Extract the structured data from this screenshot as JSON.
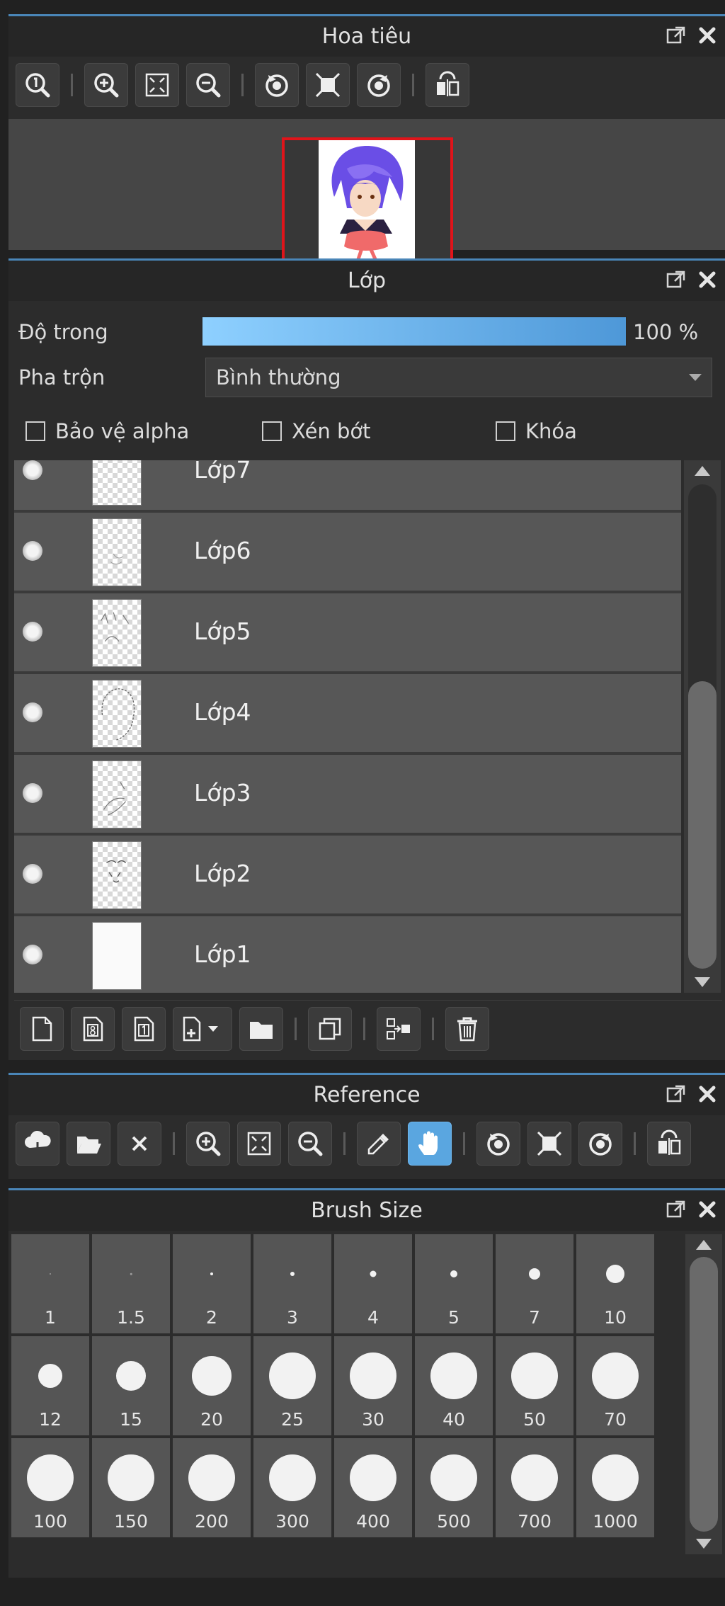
{
  "navigator": {
    "title": "Hoa tiêu"
  },
  "layers": {
    "title": "Lớp",
    "opacity_label": "Độ trong",
    "opacity_value_text": "100 %",
    "opacity_fraction": 1.0,
    "blend_label": "Pha trộn",
    "blend_value": "Bình thường",
    "check_alpha": "Bảo vệ alpha",
    "check_clip": "Xén bớt",
    "check_lock": "Khóa",
    "items": [
      {
        "name": "Lớp7"
      },
      {
        "name": "Lớp6"
      },
      {
        "name": "Lớp5"
      },
      {
        "name": "Lớp4"
      },
      {
        "name": "Lớp3"
      },
      {
        "name": "Lớp2"
      },
      {
        "name": "Lớp1"
      }
    ]
  },
  "reference": {
    "title": "Reference"
  },
  "brush": {
    "title": "Brush Size",
    "sizes": [
      "1",
      "1.5",
      "2",
      "3",
      "4",
      "5",
      "7",
      "10",
      "12",
      "15",
      "20",
      "25",
      "30",
      "40",
      "50",
      "70",
      "100",
      "150",
      "200",
      "300",
      "400",
      "500",
      "700",
      "1000"
    ]
  },
  "colors": {
    "accent": "#4a86b8",
    "active_tool": "#5aa6e0",
    "navigator_frame": "#e0141a",
    "panel_bg": "#2c2c2c",
    "layer_row": "#575757"
  },
  "icons": {
    "navigator_toolbar": [
      "actual-size-icon",
      "zoom-in-icon",
      "fit-screen-icon",
      "zoom-out-icon",
      "rotate-left-icon",
      "fit-frame-icon",
      "rotate-right-icon",
      "flip-horizontal-icon"
    ],
    "layer_toolbar": [
      "new-layer-icon",
      "new-8bit-layer-icon",
      "new-1bit-layer-icon",
      "add-layer-menu-icon",
      "folder-icon",
      "duplicate-layer-icon",
      "merge-layer-icon",
      "trash-icon"
    ],
    "reference_toolbar": [
      "import-cloud-icon",
      "open-folder-icon",
      "close-icon",
      "zoom-in-icon",
      "fit-screen-icon",
      "zoom-out-icon",
      "eyedropper-icon",
      "hand-icon",
      "rotate-left-icon",
      "fit-frame-icon",
      "rotate-right-icon",
      "flip-horizontal-icon"
    ]
  }
}
